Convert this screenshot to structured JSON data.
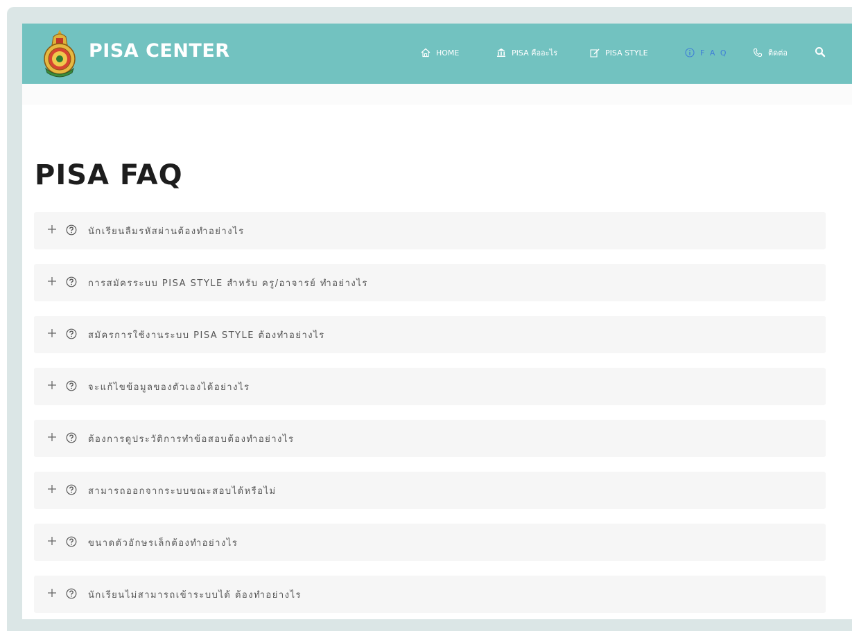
{
  "brand": {
    "name": "PISA CENTER",
    "logo_icon": "emblem-seal-icon"
  },
  "nav": {
    "items": [
      {
        "label": "HOME",
        "icon": "home-icon"
      },
      {
        "label": "PISA คืออะไร",
        "icon": "institution-icon"
      },
      {
        "label": "PISA STYLE",
        "icon": "edit-icon"
      },
      {
        "label": "F A Q",
        "icon": "info-icon",
        "active": true
      },
      {
        "label": "ติดต่อ",
        "icon": "phone-icon"
      }
    ],
    "search_icon": "search-icon",
    "active_color": "#3f7fd6"
  },
  "colors": {
    "header_bg": "#72c2c0",
    "faq_bg": "#f6f6f6"
  },
  "page": {
    "title": "PISA FAQ"
  },
  "faq": {
    "items": [
      {
        "question": "นักเรียนลืมรหัสผ่านต้องทำอย่างไร"
      },
      {
        "question": "การสมัครระบบ PISA STYLE สำหรับ ครู/อาจารย์ ทำอย่างไร"
      },
      {
        "question": "สมัครการใช้งานระบบ PISA STYLE ต้องทำอย่างไร"
      },
      {
        "question": "จะแก้ไขข้อมูลของตัวเองได้อย่างไร"
      },
      {
        "question": "ต้องการดูประวัติการทำข้อสอบต้องทำอย่างไร"
      },
      {
        "question": "สามารถออกจากระบบขณะสอบได้หรือไม่"
      },
      {
        "question": "ขนาดตัวอักษรเล็กต้องทำอย่างไร"
      },
      {
        "question": "นักเรียนไม่สามารถเข้าระบบได้ ต้องทำอย่างไร"
      }
    ]
  }
}
